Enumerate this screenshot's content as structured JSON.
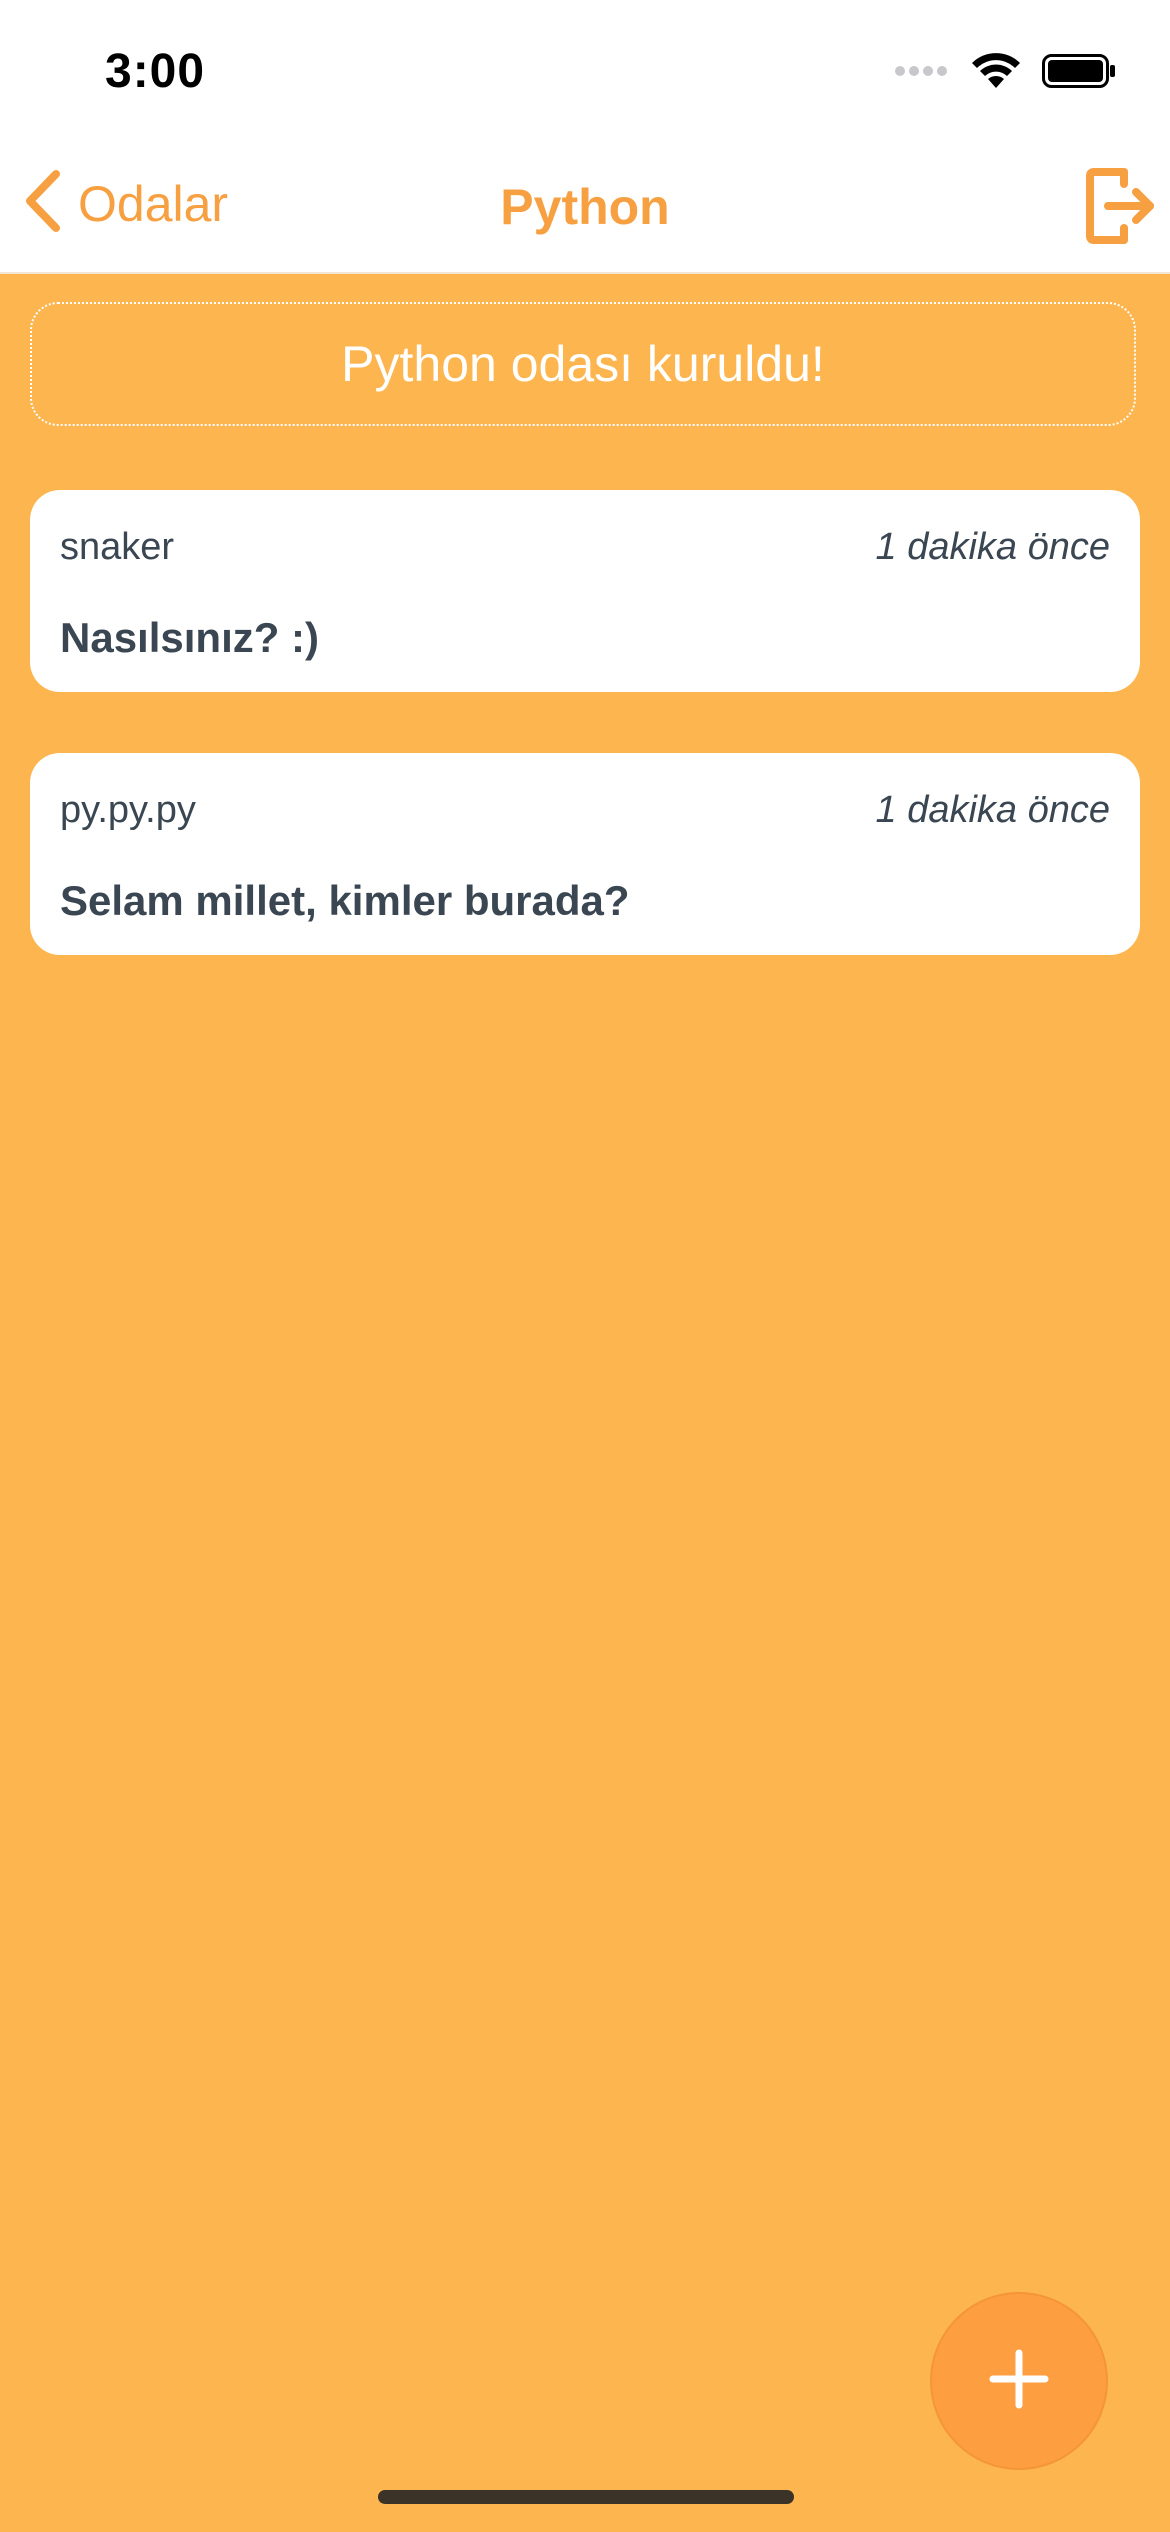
{
  "status_bar": {
    "time": "3:00",
    "icons": [
      "signal-icon",
      "wifi-icon",
      "battery-icon"
    ]
  },
  "nav": {
    "back_label": "Odalar",
    "title": "Python",
    "back_icon": "chevron-left-icon",
    "exit_icon": "exit-icon"
  },
  "room": {
    "banner_text": "Python odası kuruldu!"
  },
  "messages": [
    {
      "user": "snaker",
      "time": "1 dakika önce",
      "text": "Nasılsınız? :)"
    },
    {
      "user": "py.py.py",
      "time": "1 dakika önce",
      "text": "Selam millet, kimler burada?"
    }
  ],
  "fab": {
    "icon": "plus-icon"
  },
  "colors": {
    "accent": "#F7A041",
    "background": "#FDB54F",
    "fab": "#FD9E40",
    "card": "#FFFFFF",
    "text": "#3A4651"
  }
}
